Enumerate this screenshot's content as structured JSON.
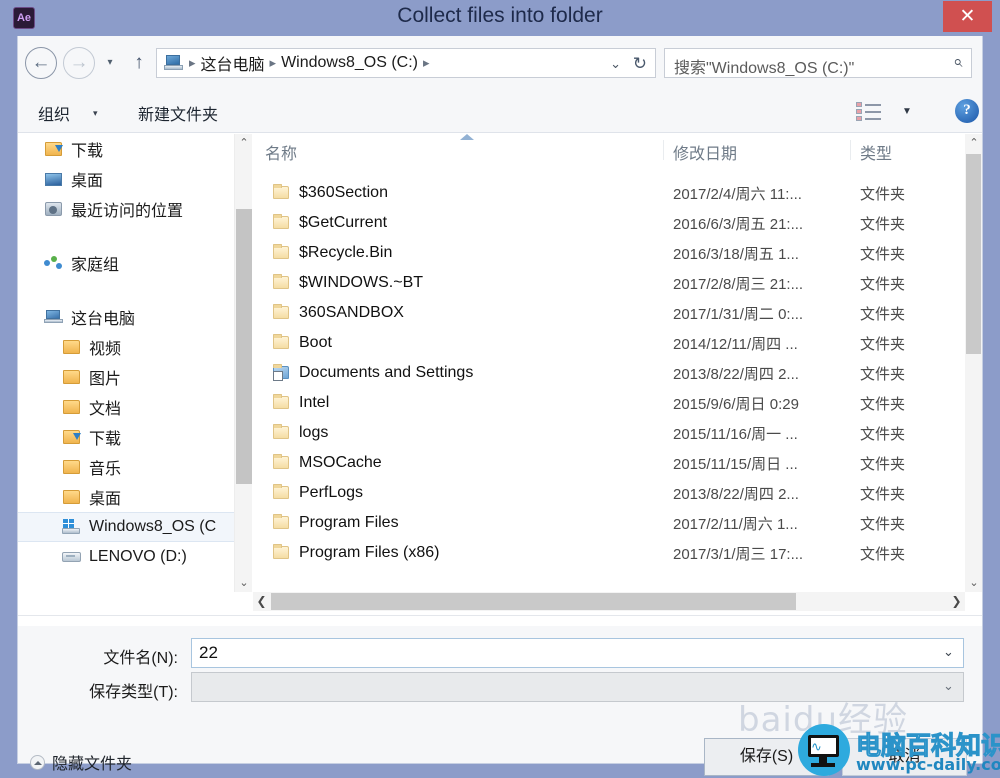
{
  "window": {
    "title": "Collect files into folder",
    "app_icon": "Ae",
    "close_label": "✕",
    "frame_color": "#8c9cc9",
    "close_color": "#d05050"
  },
  "address_bar": {
    "back_icon": "←",
    "forward_icon": "→",
    "recent_icon": "▾",
    "up_icon": "↑",
    "pc_icon": "this-pc-icon",
    "breadcrumbs": [
      "这台电脑",
      "Windows8_OS (C:)"
    ],
    "separator": "▸",
    "dropdown_icon": "⌄",
    "refresh_icon": "↻",
    "search_placeholder": "搜索\"Windows8_OS (C:)\"",
    "search_icon": "⌕"
  },
  "toolbar": {
    "organize_label": "组织",
    "organize_caret": "▾",
    "new_folder_label": "新建文件夹",
    "view_caret": "▼",
    "help_label": "?"
  },
  "sidebar": {
    "groups": [
      {
        "items": [
          {
            "label": "下载",
            "icon": "folder-download-icon",
            "indent": 0,
            "selected": false
          },
          {
            "label": "桌面",
            "icon": "desktop-icon",
            "indent": 0,
            "selected": false
          },
          {
            "label": "最近访问的位置",
            "icon": "recent-places-icon",
            "indent": 0,
            "selected": false
          }
        ]
      },
      {
        "items": [
          {
            "label": "家庭组",
            "icon": "homegroup-icon",
            "indent": 0,
            "selected": false
          }
        ]
      },
      {
        "items": [
          {
            "label": "这台电脑",
            "icon": "this-pc-icon",
            "indent": 0,
            "selected": false
          },
          {
            "label": "视频",
            "icon": "folder-video-icon",
            "indent": 1,
            "selected": false
          },
          {
            "label": "图片",
            "icon": "folder-pictures-icon",
            "indent": 1,
            "selected": false
          },
          {
            "label": "文档",
            "icon": "folder-documents-icon",
            "indent": 1,
            "selected": false
          },
          {
            "label": "下载",
            "icon": "folder-download-icon",
            "indent": 1,
            "selected": false
          },
          {
            "label": "音乐",
            "icon": "folder-music-icon",
            "indent": 1,
            "selected": false
          },
          {
            "label": "桌面",
            "icon": "folder-desktop-icon",
            "indent": 1,
            "selected": false
          },
          {
            "label": "Windows8_OS (C",
            "icon": "windows-drive-icon",
            "indent": 1,
            "selected": true
          },
          {
            "label": "LENOVO (D:)",
            "icon": "drive-icon",
            "indent": 1,
            "selected": false
          }
        ]
      }
    ],
    "scroll_up_icon": "⌃",
    "scroll_down_icon": "⌄"
  },
  "file_list": {
    "columns": [
      "名称",
      "修改日期",
      "类型"
    ],
    "sort_column": "名称",
    "sort_direction": "asc",
    "rows": [
      {
        "name": "$360Section",
        "date": "2017/2/4/周六 11:...",
        "type": "文件夹",
        "icon": "folder-icon"
      },
      {
        "name": "$GetCurrent",
        "date": "2016/6/3/周五 21:...",
        "type": "文件夹",
        "icon": "folder-icon"
      },
      {
        "name": "$Recycle.Bin",
        "date": "2016/3/18/周五 1...",
        "type": "文件夹",
        "icon": "folder-icon"
      },
      {
        "name": "$WINDOWS.~BT",
        "date": "2017/2/8/周三 21:...",
        "type": "文件夹",
        "icon": "folder-icon"
      },
      {
        "name": "360SANDBOX",
        "date": "2017/1/31/周二 0:...",
        "type": "文件夹",
        "icon": "folder-icon"
      },
      {
        "name": "Boot",
        "date": "2014/12/11/周四 ...",
        "type": "文件夹",
        "icon": "folder-icon"
      },
      {
        "name": "Documents and Settings",
        "date": "2013/8/22/周四 2...",
        "type": "文件夹",
        "icon": "junction-folder-icon"
      },
      {
        "name": "Intel",
        "date": "2015/9/6/周日 0:29",
        "type": "文件夹",
        "icon": "folder-icon"
      },
      {
        "name": "logs",
        "date": "2015/11/16/周一 ...",
        "type": "文件夹",
        "icon": "folder-icon"
      },
      {
        "name": "MSOCache",
        "date": "2015/11/15/周日 ...",
        "type": "文件夹",
        "icon": "folder-icon"
      },
      {
        "name": "PerfLogs",
        "date": "2013/8/22/周四 2...",
        "type": "文件夹",
        "icon": "folder-icon"
      },
      {
        "name": "Program Files",
        "date": "2017/2/11/周六 1...",
        "type": "文件夹",
        "icon": "folder-icon"
      },
      {
        "name": "Program Files (x86)",
        "date": "2017/3/1/周三 17:...",
        "type": "文件夹",
        "icon": "folder-icon"
      }
    ],
    "scroll_up_icon": "⌃",
    "scroll_down_icon": "⌄",
    "scroll_left_icon": "❮",
    "scroll_right_icon": "❯"
  },
  "form": {
    "filename_label": "文件名(N):",
    "filename_value": "22",
    "filename_caret": "⌄",
    "savetype_label": "保存类型(T):",
    "savetype_value": "",
    "savetype_caret": "⌄"
  },
  "footer": {
    "hide_folders_label": "隐藏文件夹",
    "save_label": "保存(S)",
    "cancel_label": "取消"
  },
  "watermark": {
    "baidu_text": "baidu经验",
    "brand_cn": "电脑百科知识",
    "brand_url": "www.pc-daily.com",
    "brand_color": "#2eaade"
  }
}
